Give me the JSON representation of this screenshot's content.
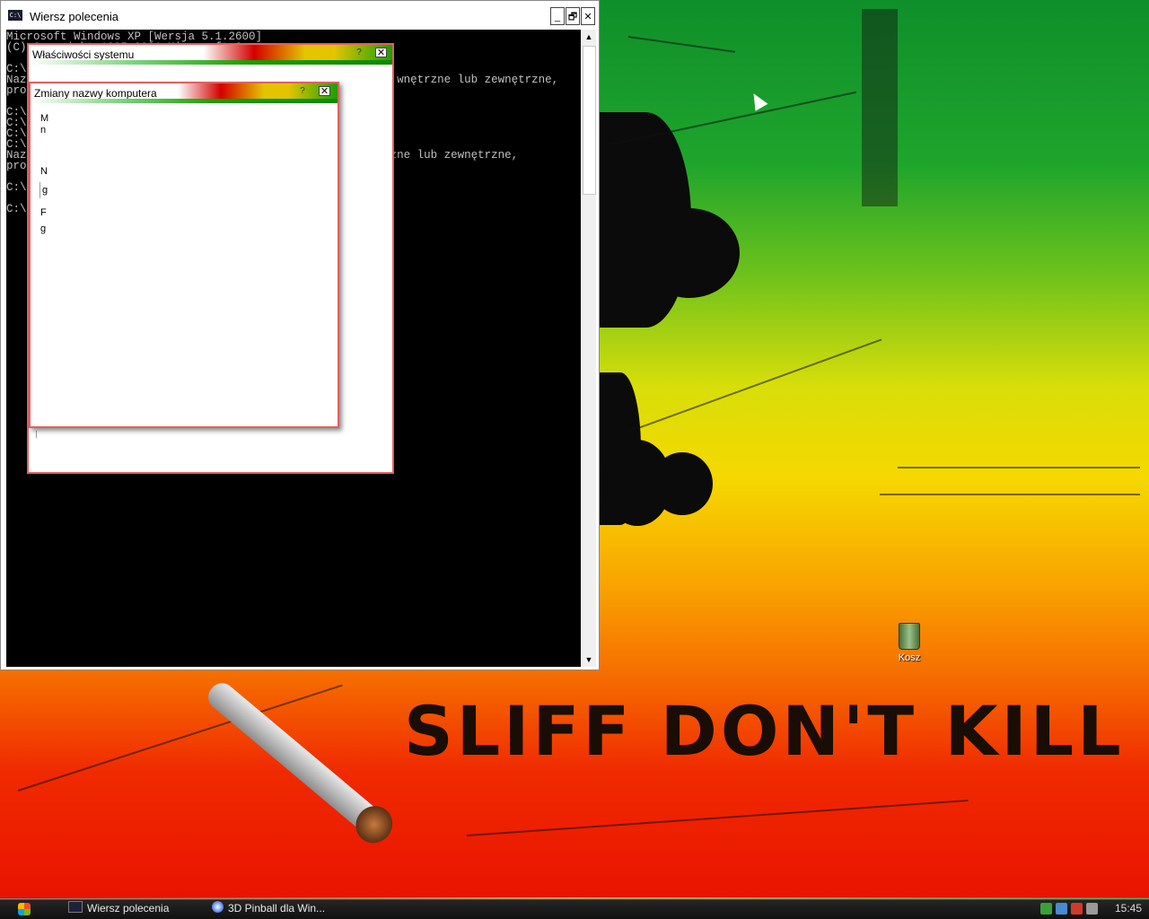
{
  "desktop": {
    "slogan": "SLIFF DON'T KILL",
    "icons": [
      {
        "label": "Kosz",
        "icon": "recycle-bin-icon"
      }
    ]
  },
  "console_window": {
    "title": "Wiersz polecenia",
    "icon": "console-icon",
    "buttons": {
      "minimize": "_",
      "restore": "🗗",
      "close": "✕"
    },
    "lines": [
      "Microsoft Windows XP [Wersja 5.1.2600]",
      "(C) Copyright 1985-2001 Microsoft Corp.",
      "",
      "C:\\",
      "Naz                                                       wnętrzne lub zewnętrzne,",
      "pro",
      "",
      "C:\\",
      "C:\\",
      "C:\\",
      "C:\\",
      "Naz                                                    trzne lub zewnętrzne,",
      "pro",
      "",
      "C:\\",
      "",
      "C:\\"
    ]
  },
  "system_properties_dialog": {
    "title": "Właściwości systemu",
    "help": "?",
    "close": "✕"
  },
  "rename_computer_dialog": {
    "title": "Zmiany nazwy komputera",
    "help": "?",
    "close": "✕",
    "fragments": [
      "M",
      "n",
      "N",
      "g",
      "F",
      "g"
    ]
  },
  "taskbar": {
    "tasks": [
      {
        "label": "Wiersz polecenia",
        "icon": "console-icon"
      },
      {
        "label": "3D Pinball dla Win...",
        "icon": "pinball-icon"
      }
    ],
    "tray": {
      "clock": "15:45"
    }
  },
  "colors": {
    "rasta_red": "#e00000",
    "rasta_yellow": "#e8c000",
    "rasta_green": "#18a000",
    "console_bg": "#000000",
    "console_fg": "#c0c0c0"
  }
}
